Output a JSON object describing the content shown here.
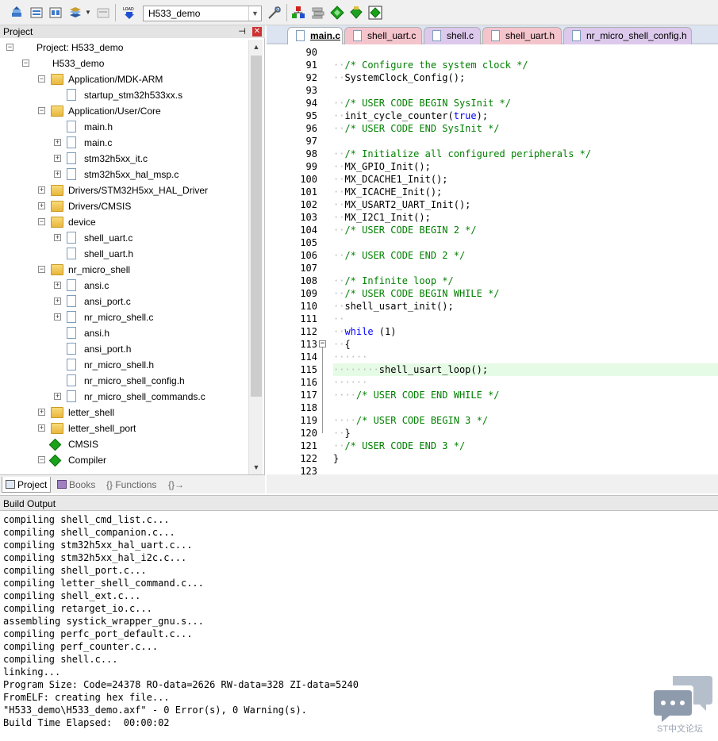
{
  "toolbar": {
    "target_name": "H533_demo",
    "icons": [
      "translate-icon",
      "build-icon",
      "rebuild-icon",
      "batch-build-icon",
      "stop-build-icon",
      "download-icon",
      "target-options-icon",
      "manage-components-icon",
      "select-packs-icon",
      "pack-installer-icon",
      "run-time-env-icon"
    ]
  },
  "project": {
    "title": "Project",
    "tree": [
      {
        "label": "Project: H533_demo",
        "level": 0,
        "icon": "project",
        "exp": "-"
      },
      {
        "label": "H533_demo",
        "level": 1,
        "icon": "project",
        "exp": "-"
      },
      {
        "label": "Application/MDK-ARM",
        "level": 2,
        "icon": "folder",
        "exp": "-"
      },
      {
        "label": "startup_stm32h533xx.s",
        "level": 3,
        "icon": "file",
        "exp": ""
      },
      {
        "label": "Application/User/Core",
        "level": 2,
        "icon": "folder",
        "exp": "-"
      },
      {
        "label": "main.h",
        "level": 3,
        "icon": "file",
        "exp": ""
      },
      {
        "label": "main.c",
        "level": 3,
        "icon": "file",
        "exp": "+"
      },
      {
        "label": "stm32h5xx_it.c",
        "level": 3,
        "icon": "file",
        "exp": "+"
      },
      {
        "label": "stm32h5xx_hal_msp.c",
        "level": 3,
        "icon": "file",
        "exp": "+"
      },
      {
        "label": "Drivers/STM32H5xx_HAL_Driver",
        "level": 2,
        "icon": "folder",
        "exp": "+"
      },
      {
        "label": "Drivers/CMSIS",
        "level": 2,
        "icon": "folder",
        "exp": "+"
      },
      {
        "label": "device",
        "level": 2,
        "icon": "folder",
        "exp": "-"
      },
      {
        "label": "shell_uart.c",
        "level": 3,
        "icon": "file",
        "exp": "+"
      },
      {
        "label": "shell_uart.h",
        "level": 3,
        "icon": "file",
        "exp": ""
      },
      {
        "label": "nr_micro_shell",
        "level": 2,
        "icon": "folder",
        "exp": "-"
      },
      {
        "label": "ansi.c",
        "level": 3,
        "icon": "file",
        "exp": "+"
      },
      {
        "label": "ansi_port.c",
        "level": 3,
        "icon": "file",
        "exp": "+"
      },
      {
        "label": "nr_micro_shell.c",
        "level": 3,
        "icon": "file",
        "exp": "+"
      },
      {
        "label": "ansi.h",
        "level": 3,
        "icon": "file",
        "exp": ""
      },
      {
        "label": "ansi_port.h",
        "level": 3,
        "icon": "file",
        "exp": ""
      },
      {
        "label": "nr_micro_shell.h",
        "level": 3,
        "icon": "file",
        "exp": ""
      },
      {
        "label": "nr_micro_shell_config.h",
        "level": 3,
        "icon": "file",
        "exp": ""
      },
      {
        "label": "nr_micro_shell_commands.c",
        "level": 3,
        "icon": "file",
        "exp": "+"
      },
      {
        "label": "letter_shell",
        "level": 2,
        "icon": "folder",
        "exp": "+"
      },
      {
        "label": "letter_shell_port",
        "level": 2,
        "icon": "folder",
        "exp": "+"
      },
      {
        "label": "CMSIS",
        "level": 2,
        "icon": "diamond",
        "exp": ""
      },
      {
        "label": "Compiler",
        "level": 2,
        "icon": "diamond",
        "exp": "-"
      }
    ],
    "tabs": [
      "Project",
      "Books",
      "{} Functions",
      "{}→ Templates"
    ]
  },
  "editor": {
    "tabs": [
      {
        "label": "main.c",
        "color": "#e6eefc",
        "active": true
      },
      {
        "label": "shell_uart.c",
        "color": "#f4c4cc"
      },
      {
        "label": "shell.c",
        "color": "#dcc9ec"
      },
      {
        "label": "shell_uart.h",
        "color": "#f4c4cc"
      },
      {
        "label": "nr_micro_shell_config.h",
        "color": "#dcc9ec"
      }
    ],
    "current_line": 115,
    "lines": [
      {
        "n": "90",
        "t": ""
      },
      {
        "n": "91",
        "t": "/* Configure the system clock */",
        "c": "cm",
        "ind": 1
      },
      {
        "n": "92",
        "t": "SystemClock_Config();",
        "ind": 1
      },
      {
        "n": "93",
        "t": ""
      },
      {
        "n": "94",
        "t": "/* USER CODE BEGIN SysInit */",
        "c": "cm",
        "ind": 1
      },
      {
        "n": "95",
        "t": "init_cycle_counter(true);",
        "ind": 1,
        "kwpart": "true"
      },
      {
        "n": "96",
        "t": "/* USER CODE END SysInit */",
        "c": "cm",
        "ind": 1
      },
      {
        "n": "97",
        "t": ""
      },
      {
        "n": "98",
        "t": "/* Initialize all configured peripherals */",
        "c": "cm",
        "ind": 1
      },
      {
        "n": "99",
        "t": "MX_GPIO_Init();",
        "ind": 1
      },
      {
        "n": "100",
        "t": "MX_DCACHE1_Init();",
        "ind": 1
      },
      {
        "n": "101",
        "t": "MX_ICACHE_Init();",
        "ind": 1
      },
      {
        "n": "102",
        "t": "MX_USART2_UART_Init();",
        "ind": 1
      },
      {
        "n": "103",
        "t": "MX_I2C1_Init();",
        "ind": 1
      },
      {
        "n": "104",
        "t": "/* USER CODE BEGIN 2 */",
        "c": "cm",
        "ind": 1
      },
      {
        "n": "105",
        "t": ""
      },
      {
        "n": "106",
        "t": "/* USER CODE END 2 */",
        "c": "cm",
        "ind": 1
      },
      {
        "n": "107",
        "t": ""
      },
      {
        "n": "108",
        "t": "/* Infinite loop */",
        "c": "cm",
        "ind": 1
      },
      {
        "n": "109",
        "t": "/* USER CODE BEGIN WHILE */",
        "c": "cm",
        "ind": 1
      },
      {
        "n": "110",
        "t": "shell_usart_init();",
        "ind": 1
      },
      {
        "n": "111",
        "t": "",
        "ind": 1
      },
      {
        "n": "112",
        "t": "while (1)",
        "ind": 1,
        "kwpart": "while"
      },
      {
        "n": "113",
        "t": "{",
        "ind": 1
      },
      {
        "n": "114",
        "t": "",
        "ind": 3
      },
      {
        "n": "115",
        "t": "shell_usart_loop();",
        "ind": 4
      },
      {
        "n": "116",
        "t": "",
        "ind": 3
      },
      {
        "n": "117",
        "t": "/* USER CODE END WHILE */",
        "c": "cm",
        "ind": 2
      },
      {
        "n": "118",
        "t": ""
      },
      {
        "n": "119",
        "t": "/* USER CODE BEGIN 3 */",
        "c": "cm",
        "ind": 2
      },
      {
        "n": "120",
        "t": "}",
        "ind": 1
      },
      {
        "n": "121",
        "t": "/* USER CODE END 3 */",
        "c": "cm",
        "ind": 1
      },
      {
        "n": "122",
        "t": "}",
        "ind": 0
      },
      {
        "n": "123",
        "t": ""
      }
    ]
  },
  "build": {
    "title": "Build Output",
    "lines": [
      "compiling shell_cmd_list.c...",
      "compiling shell_companion.c...",
      "compiling stm32h5xx_hal_uart.c...",
      "compiling stm32h5xx_hal_i2c.c...",
      "compiling shell_port.c...",
      "compiling letter_shell_command.c...",
      "compiling shell_ext.c...",
      "compiling retarget_io.c...",
      "assembling systick_wrapper_gnu.s...",
      "compiling perfc_port_default.c...",
      "compiling perf_counter.c...",
      "compiling shell.c...",
      "linking...",
      "Program Size: Code=24378 RO-data=2626 RW-data=328 ZI-data=5240",
      "FromELF: creating hex file...",
      "\"H533_demo\\H533_demo.axf\" - 0 Error(s), 0 Warning(s).",
      "Build Time Elapsed:  00:00:02"
    ]
  },
  "watermark": {
    "text": "ST中文论坛"
  }
}
